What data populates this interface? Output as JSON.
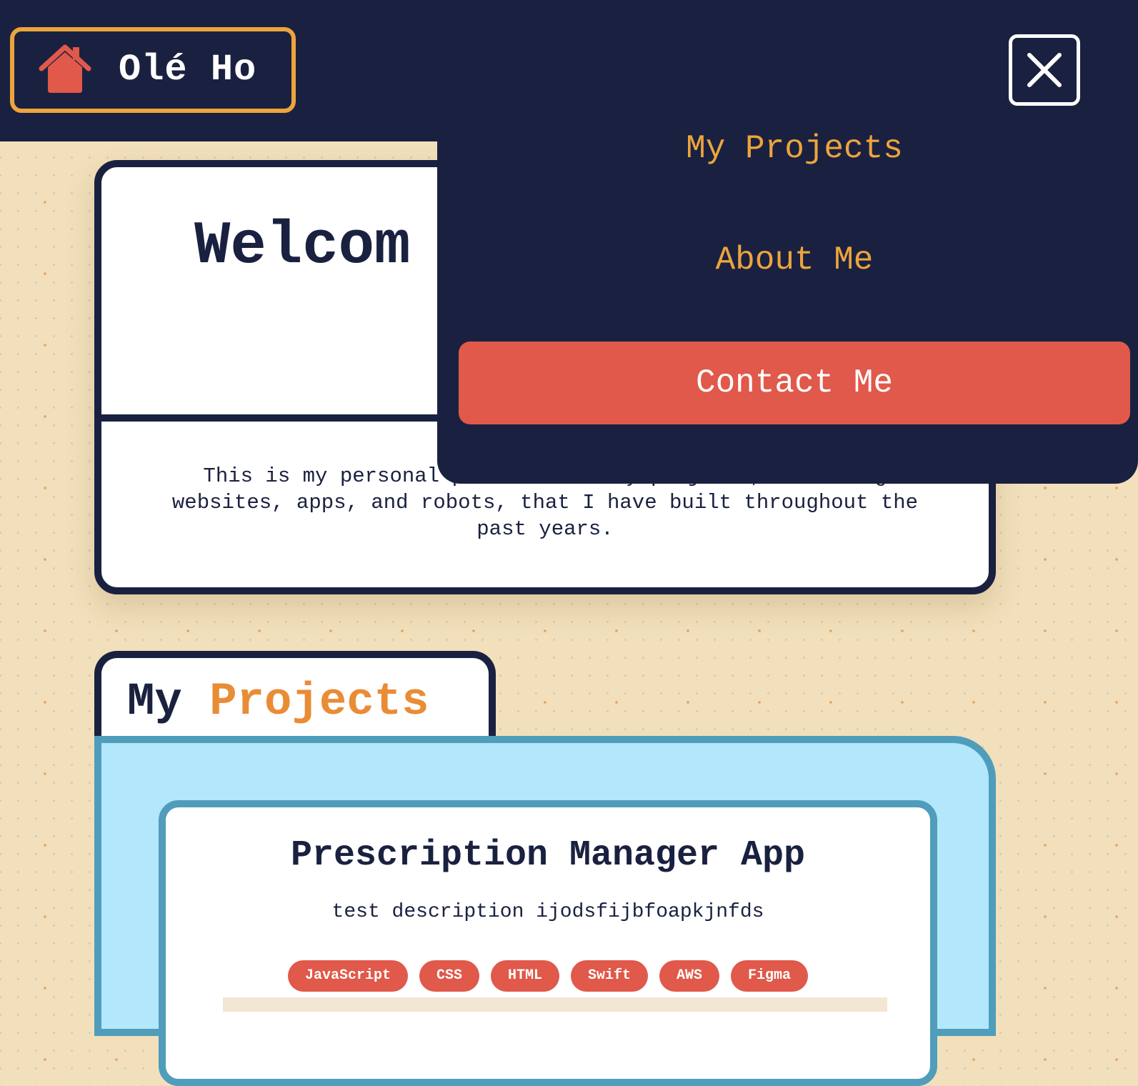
{
  "header": {
    "brand_name": "Olé Ho",
    "home_icon": "house-icon",
    "close_icon": "close-icon"
  },
  "welcome": {
    "title": "Welcom",
    "description": "This is my personal portfolio of my projects, including websites, apps, and robots, that I have built throughout the past years."
  },
  "nav_menu": {
    "items": [
      {
        "label": "My Projects"
      },
      {
        "label": "About Me"
      }
    ],
    "contact_label": "Contact Me"
  },
  "projects_section": {
    "heading_word1": "My",
    "heading_word2": "Projects",
    "cards": [
      {
        "title": "Prescription Manager App",
        "description": "test description ijodsfijbfoapkjnfds",
        "tags": [
          "JavaScript",
          "CSS",
          "HTML",
          "Swift",
          "AWS",
          "Figma"
        ]
      }
    ]
  },
  "colors": {
    "navy": "#1a2140",
    "accent_orange": "#eda43d",
    "projects_orange": "#e98c36",
    "contact_red": "#e0594a",
    "projects_bg": "#b3e7fb",
    "projects_border": "#4f9dbb",
    "page_bg": "#f1e0bb"
  }
}
